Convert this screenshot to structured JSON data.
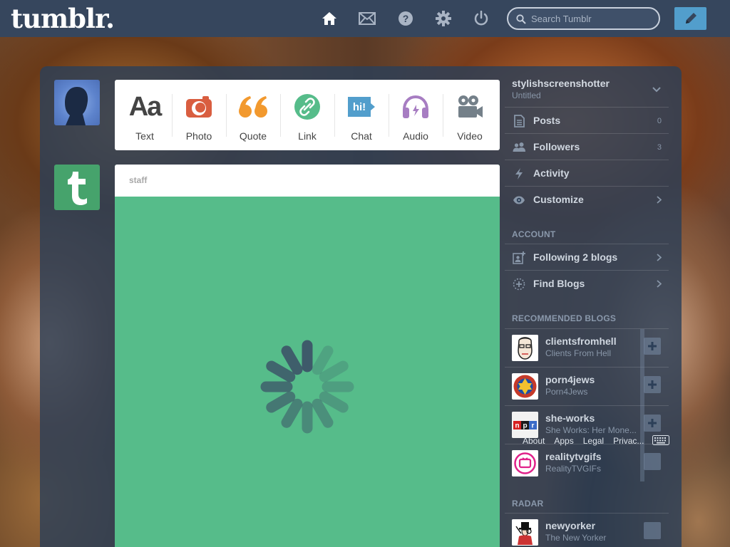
{
  "header": {
    "logo": "tumblr.",
    "search": {
      "placeholder": "Search Tumblr"
    },
    "nav_icons": [
      "home-icon",
      "mail-icon",
      "help-icon",
      "gear-icon",
      "power-icon"
    ],
    "compose_icon": "pencil-icon",
    "accent_color": "#529ecc",
    "bar_color": "#36465d"
  },
  "post_types": [
    {
      "label": "Text",
      "glyph": "Aa",
      "color": "#444444"
    },
    {
      "label": "Photo",
      "color": "#d95e40"
    },
    {
      "label": "Quote",
      "color": "#f2992e"
    },
    {
      "label": "Link",
      "color": "#56bc8a"
    },
    {
      "label": "Chat",
      "glyph": "hi!",
      "color": "#529ecc"
    },
    {
      "label": "Audio",
      "color": "#a77dc2"
    },
    {
      "label": "Video",
      "color": "#748089"
    }
  ],
  "post": {
    "blog": "staff",
    "background": "#56bc8a"
  },
  "sidebar": {
    "blog_name": "stylishscreenshotter",
    "blog_title": "Untitled",
    "items": [
      {
        "label": "Posts",
        "count": "0"
      },
      {
        "label": "Followers",
        "count": "3"
      },
      {
        "label": "Activity"
      },
      {
        "label": "Customize"
      }
    ],
    "account_heading": "ACCOUNT",
    "account_items": [
      {
        "label": "Following 2 blogs"
      },
      {
        "label": "Find Blogs"
      }
    ],
    "recommended_heading": "RECOMMENDED BLOGS",
    "recommended": [
      {
        "name": "clientsfromhell",
        "title": "Clients From Hell"
      },
      {
        "name": "porn4jews",
        "title": "Porn4Jews"
      },
      {
        "name": "she-works",
        "title": "She Works: Her Mone..."
      },
      {
        "name": "realitytvgifs",
        "title": "RealityTVGIFs"
      }
    ],
    "radar_heading": "RADAR",
    "radar": {
      "name": "newyorker",
      "title": "The New Yorker"
    }
  },
  "footer": {
    "links": [
      "About",
      "Apps",
      "Legal",
      "Privac..."
    ]
  }
}
